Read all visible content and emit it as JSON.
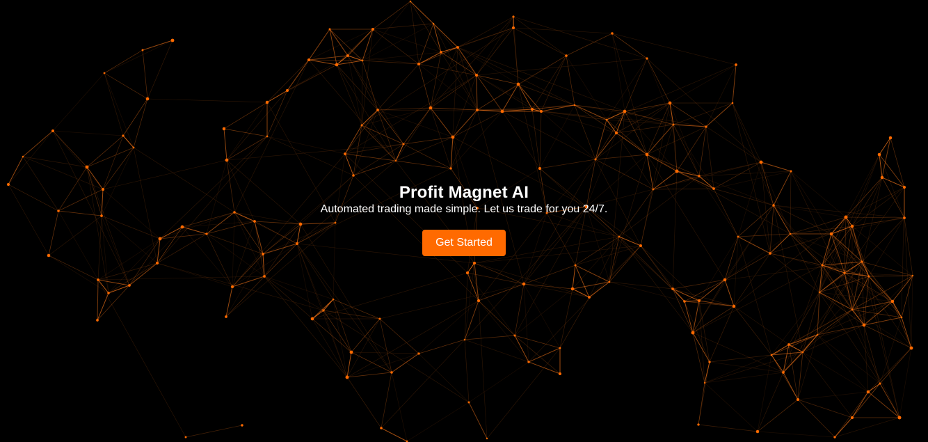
{
  "hero": {
    "title": "Profit Magnet AI",
    "subtitle": "Automated trading made simple. Let us trade for you 24/7.",
    "cta_label": "Get Started"
  },
  "colors": {
    "background": "#000000",
    "accent": "#ff6a00",
    "network_line": "#ff7a1a",
    "network_node": "#ff6a00",
    "text": "#ffffff"
  },
  "background_decoration": "particle-network"
}
